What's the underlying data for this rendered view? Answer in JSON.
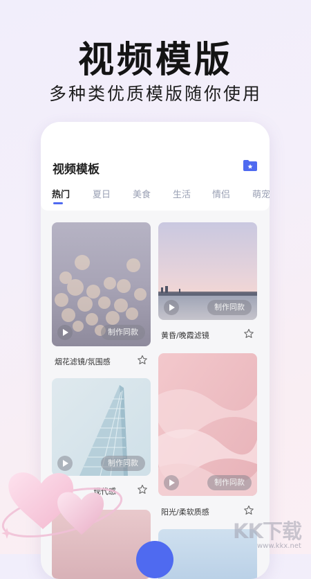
{
  "hero": {
    "title": "视频模版",
    "subtitle": "多种类优质模版随你使用"
  },
  "panel": {
    "title": "视频模板",
    "folder_icon": "folder-star-icon",
    "tabs": [
      {
        "label": "热门",
        "active": true
      },
      {
        "label": "夏日",
        "active": false
      },
      {
        "label": "美食",
        "active": false
      },
      {
        "label": "生活",
        "active": false
      },
      {
        "label": "情侣",
        "active": false
      },
      {
        "label": "萌宠",
        "active": false
      }
    ],
    "accent_color": "#4f6af0"
  },
  "cards": [
    {
      "label": "烟花滤镜/氛围感",
      "button": "制作同款"
    },
    {
      "label": "黄昏/晚霞滤镜",
      "button": "制作同款"
    },
    {
      "label": "现代感",
      "button": "制作同款"
    },
    {
      "label": "阳光/柔软质感",
      "button": "制作同款"
    }
  ],
  "watermark": {
    "brand": "KK下载",
    "url": "www.kkx.net"
  }
}
